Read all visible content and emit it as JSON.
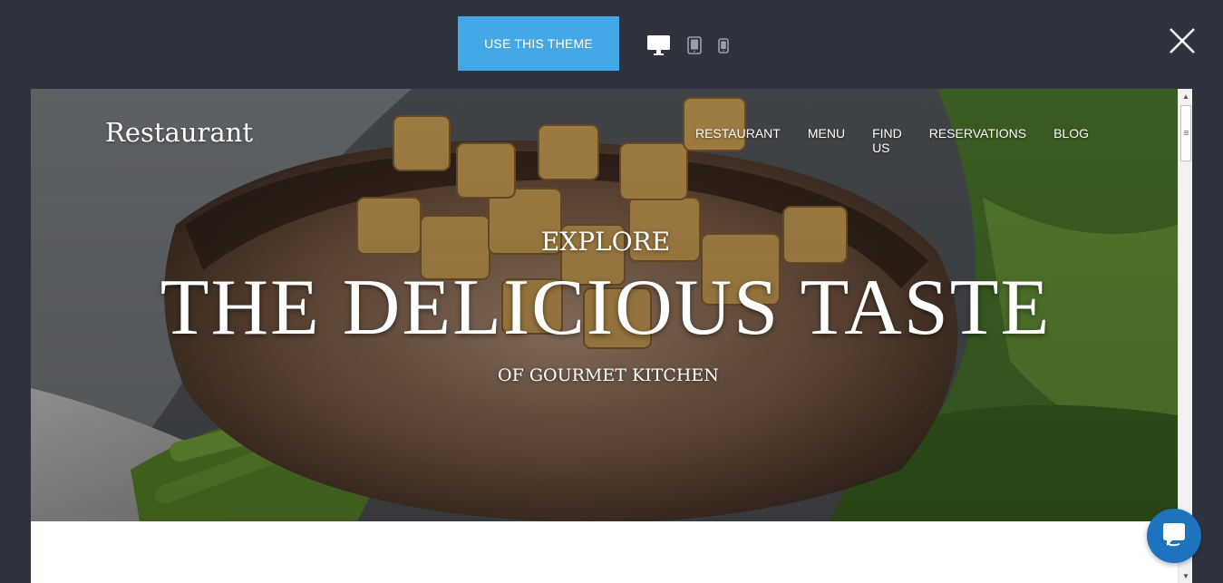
{
  "toolbar": {
    "use_theme_label": "USE THIS THEME",
    "devices": [
      "desktop",
      "tablet",
      "mobile"
    ],
    "active_device": "desktop",
    "accent_color": "#44a8e6",
    "background_color": "#2f3340"
  },
  "site": {
    "brand": "Restaurant",
    "nav": [
      "RESTAURANT",
      "MENU",
      "FIND US",
      "RESERVATIONS",
      "BLOG"
    ],
    "hero": {
      "kicker": "EXPLORE",
      "headline": "THE DELICIOUS TASTE",
      "subline": "OF GOURMET KITCHEN"
    }
  },
  "icons": {
    "close": "close-icon",
    "chat": "chat-icon",
    "desktop": "desktop-icon",
    "tablet": "tablet-icon",
    "mobile": "mobile-icon"
  }
}
